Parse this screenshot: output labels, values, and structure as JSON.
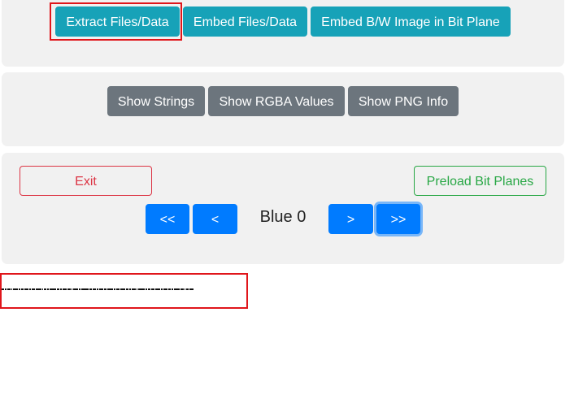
{
  "toolbar_top": {
    "extract_label": "Extract Files/Data",
    "embed_label": "Embed Files/Data",
    "embed_bw_label": "Embed B/W Image in Bit Plane"
  },
  "toolbar_mid": {
    "strings_label": "Show Strings",
    "rgba_label": "Show RGBA Values",
    "png_info_label": "Show PNG Info"
  },
  "nav": {
    "exit_label": "Exit",
    "preload_label": "Preload Bit Planes",
    "first_label": "<<",
    "prev_label": "<",
    "current_plane": "Blue 0",
    "next_label": ">",
    "last_label": ">>"
  },
  "colors": {
    "info": "#17a2b8",
    "secondary": "#6c757d",
    "primary": "#007bff",
    "danger": "#dc3545",
    "success": "#28a745",
    "highlight": "#e0161b"
  }
}
